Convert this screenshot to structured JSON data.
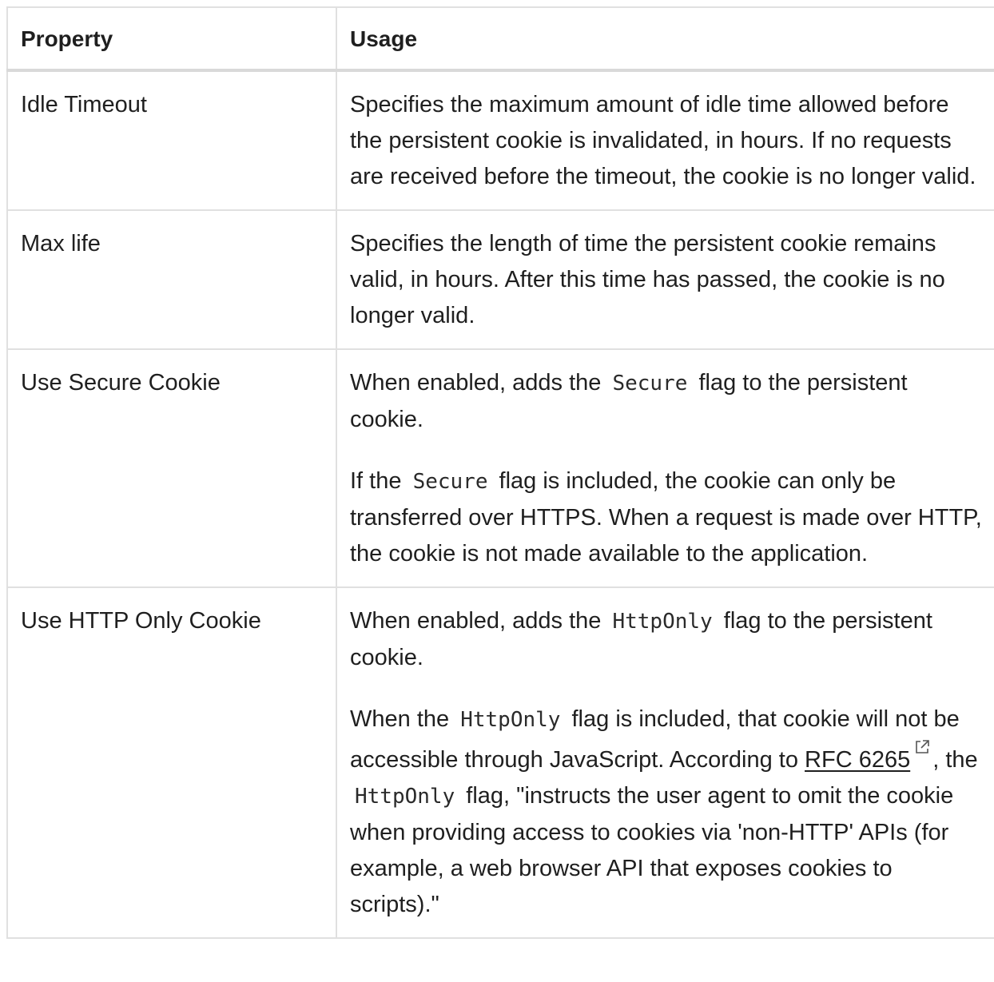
{
  "table": {
    "headers": {
      "property": "Property",
      "usage": "Usage"
    },
    "rows": [
      {
        "property": "Idle Timeout",
        "usage": {
          "p1": "Specifies the maximum amount of idle time allowed before the persistent cookie is invalidated, in hours. If no requests are received before the timeout, the cookie is no longer valid."
        }
      },
      {
        "property": "Max life",
        "usage": {
          "p1": "Specifies the length of time the persistent cookie remains valid, in hours. After this time has passed, the cookie is no longer valid."
        }
      },
      {
        "property": "Use Secure Cookie",
        "usage": {
          "p1_before": "When enabled, adds the",
          "p1_code": "Secure",
          "p1_after": "flag to the persistent cookie.",
          "p2_before": "If the",
          "p2_code": "Secure",
          "p2_after": "flag is included, the cookie can only be transferred over HTTPS. When a request is made over HTTP, the cookie is not made available to the application."
        }
      },
      {
        "property": "Use HTTP Only Cookie",
        "usage": {
          "p1_before": "When enabled, adds the",
          "p1_code": "HttpOnly",
          "p1_after": "flag to the persistent cookie.",
          "p2_before": "When the",
          "p2_code": "HttpOnly",
          "p2_middle": "flag is included, that cookie will not be accessible through JavaScript. According to",
          "p2_link": "RFC 6265",
          "p2_link_icon": "external-link-icon",
          "p2_after_link": ", the",
          "p2_code2": "HttpOnly",
          "p2_end": "flag, \"instructs the user agent to omit the cookie when providing access to cookies via 'non-HTTP' APIs (for example, a web browser API that exposes cookies to scripts).\""
        }
      }
    ]
  },
  "colors": {
    "border": "#e0e0e0",
    "text": "#1f1f1f"
  }
}
